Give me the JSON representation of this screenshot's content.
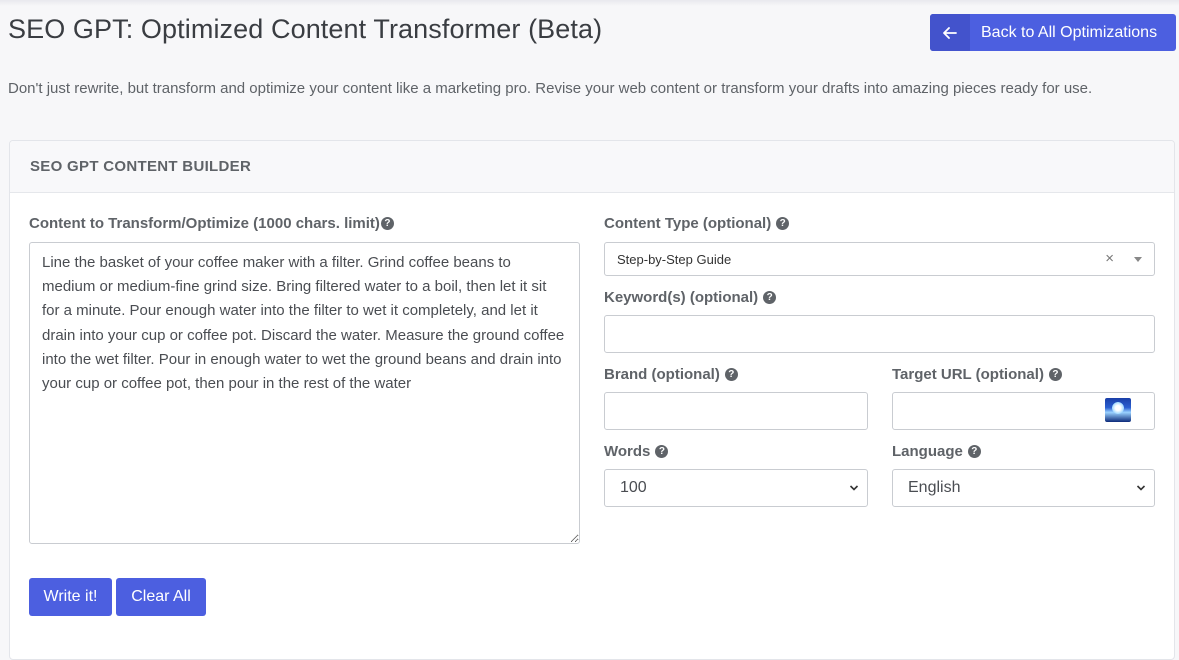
{
  "header": {
    "title": "SEO GPT: Optimized Content Transformer (Beta)",
    "back_button_label": "Back to All Optimizations",
    "back_icon": "arrow-left-icon"
  },
  "intro_text": "Don't just rewrite, but transform and optimize your content like a marketing pro. Revise your web content or transform your drafts into amazing pieces ready for use.",
  "card": {
    "title": "SEO GPT CONTENT BUILDER",
    "content": {
      "label": "Content to Transform/Optimize (1000 chars. limit)",
      "value": "Line the basket of your coffee maker with a filter. Grind coffee beans to medium or medium-fine grind size. Bring filtered water to a boil, then let it sit for a minute. Pour enough water into the filter to wet it completely, and let it drain into your cup or coffee pot. Discard the water. Measure the ground coffee into the wet filter. Pour in enough water to wet the ground beans and drain into your cup or coffee pot, then pour in the rest of the water"
    },
    "content_type": {
      "label": "Content Type (optional)",
      "value": "Step-by-Step Guide",
      "clear_symbol": "×"
    },
    "keywords": {
      "label": "Keyword(s) (optional)",
      "value": ""
    },
    "brand": {
      "label": "Brand (optional)",
      "value": ""
    },
    "target_url": {
      "label": "Target URL (optional)",
      "value": ""
    },
    "words": {
      "label": "Words",
      "value": "100"
    },
    "language": {
      "label": "Language",
      "value": "English"
    },
    "help_symbol": "?",
    "buttons": {
      "write": "Write it!",
      "clear": "Clear All"
    }
  }
}
